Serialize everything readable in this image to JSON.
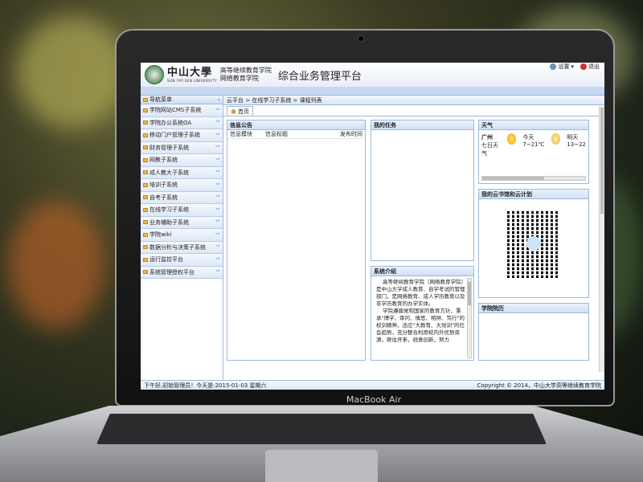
{
  "chin_label": "MacBook Air",
  "header": {
    "school_cn": "中山大學",
    "school_en": "SUN YAT-SEN UNIVERSITY",
    "college_line1": "高等继续教育学院",
    "college_line2": "网络教育学院",
    "platform_title": "综合业务管理平台",
    "settings_label": "设置",
    "logout_label": "退出"
  },
  "sidebar": {
    "title": "导航菜单",
    "collapse": "«",
    "items": [
      {
        "label": "学院网站CMS子系统"
      },
      {
        "label": "学院办公系统OA"
      },
      {
        "label": "移动门户管理子系统"
      },
      {
        "label": "财务管理子系统"
      },
      {
        "label": "网教子系统"
      },
      {
        "label": "成人教大子系统"
      },
      {
        "label": "培训子系统"
      },
      {
        "label": "自考子系统"
      },
      {
        "label": "在线学习子系统"
      },
      {
        "label": "业务辅助子系统"
      },
      {
        "label": "学院wiki"
      },
      {
        "label": "数据分析与决策子系统"
      },
      {
        "label": "运行监控平台"
      },
      {
        "label": "系统管理授权平台"
      }
    ]
  },
  "breadcrumb": "云平台 > 在线学习子系统 > 课程列表",
  "tab_home": "首页",
  "panels": {
    "notice": {
      "title": "信息公告",
      "col1": "信息模块",
      "col2": "信息标题",
      "col3": "发布时间"
    },
    "tasks": {
      "title": "我的任务"
    },
    "weather": {
      "title": "天气",
      "city": "广州",
      "forecast": "七日天气",
      "today_label": "今天",
      "today_temp": "7~21℃",
      "tomorrow_label": "明天",
      "tomorrow_temp": "13~22"
    },
    "cloud": {
      "title": "我的云书馆和云计划"
    },
    "intro": {
      "title": "系统介绍",
      "p1": "高等继续教育学院（网络教育学院）是中山大学成人教育、自学考试的管理部门，是网络教育、成人学历教育以及非学历教育的办学实体。",
      "p2": "学院遵循党和国家的教育方针，秉承\"博学、审问、慎思、明辨、笃行\"的校训精神，适应\"大教育、大培训\"的社会趋势，充分整合利用校内外优势资源，继往开来，锐意创新，努力"
    },
    "calendar": {
      "title": "学院院历"
    }
  },
  "status": {
    "greeting": "下午好,初始管理员！今天是:2015-01-03 星期六",
    "copyright": "Copyright © 2014，中山大学高等继续教育学院"
  },
  "colors": {
    "accent": "#9db8dc",
    "header_bg": "#c5d8ef"
  }
}
